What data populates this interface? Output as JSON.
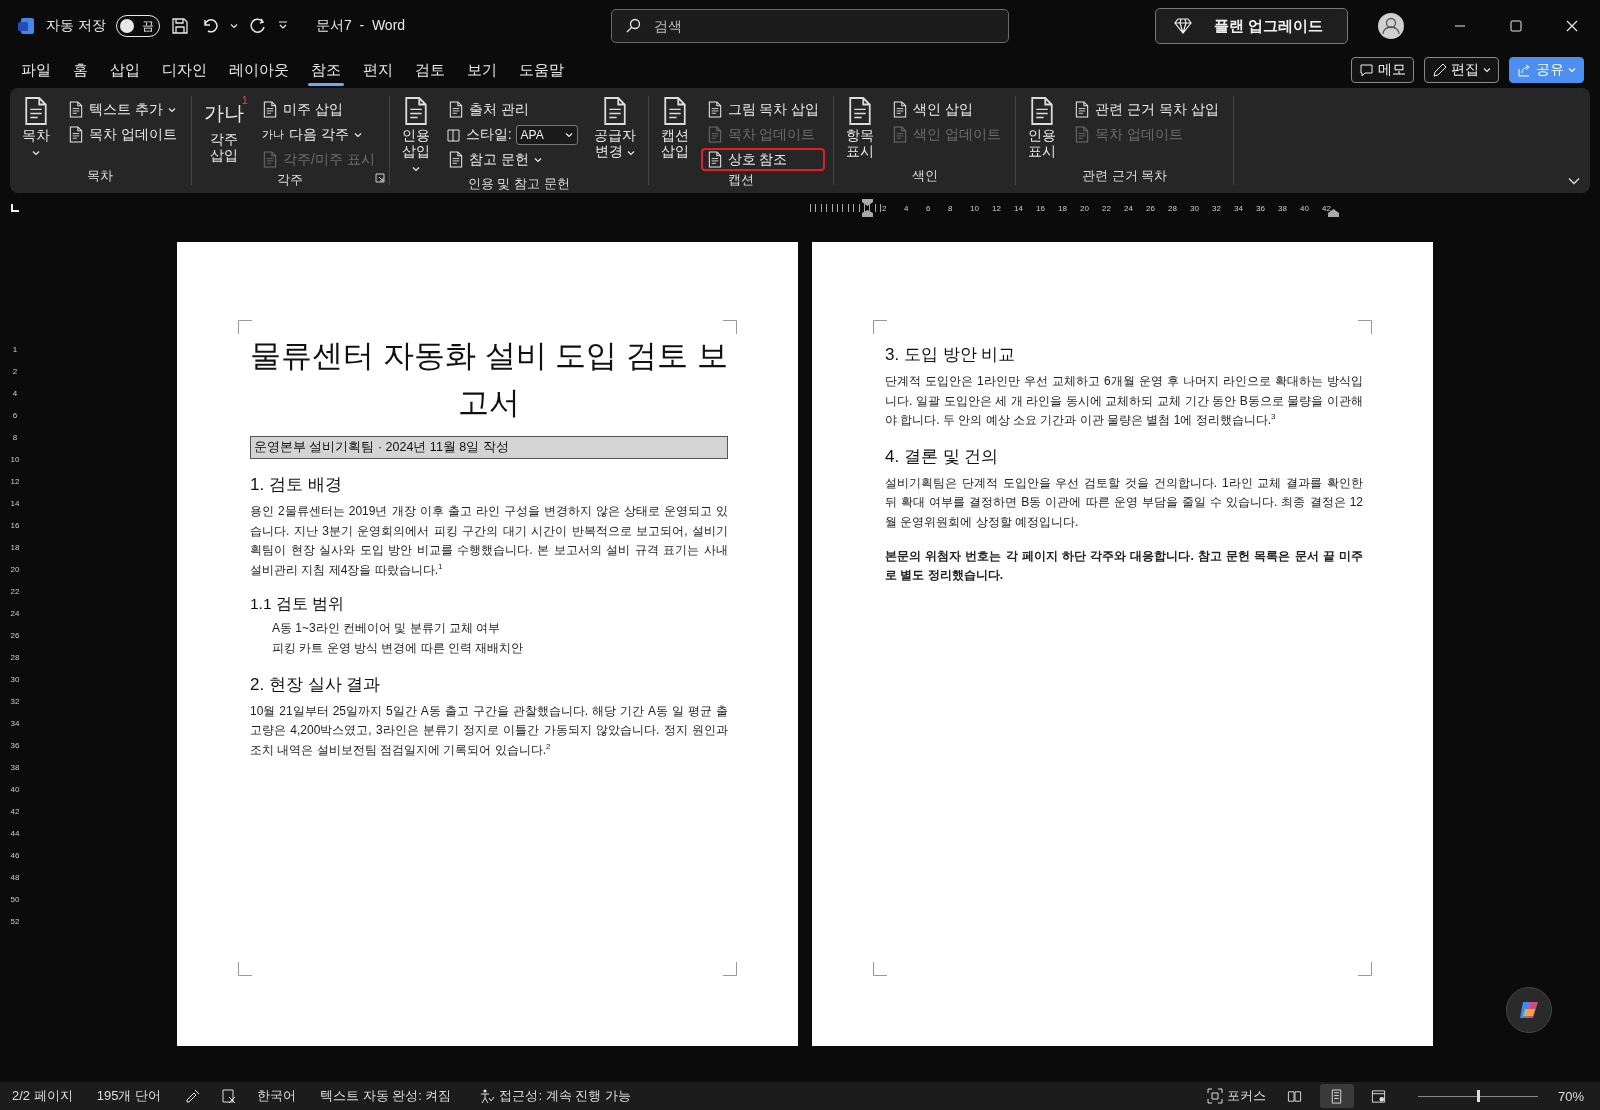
{
  "title_bar": {
    "autosave": {
      "label": "자동 저장",
      "on": false,
      "state_text": "끔"
    },
    "title": "문서7  -  Word",
    "search": {
      "placeholder": "검색"
    },
    "upgrade": "플랜 업그레이드"
  },
  "menu_tabs": [
    {
      "label": "파일",
      "selected": false
    },
    {
      "label": "홈",
      "selected": false
    },
    {
      "label": "삽입",
      "selected": false
    },
    {
      "label": "디자인",
      "selected": false
    },
    {
      "label": "레이아웃",
      "selected": false
    },
    {
      "label": "참조",
      "selected": true
    },
    {
      "label": "편지",
      "selected": false
    },
    {
      "label": "검토",
      "selected": false
    },
    {
      "label": "보기",
      "selected": false
    },
    {
      "label": "도움말",
      "selected": false
    }
  ],
  "header_buttons": [
    {
      "kind": "comment",
      "label": "메모"
    },
    {
      "kind": "edit",
      "label": "편집"
    },
    {
      "kind": "share",
      "label": "공유"
    }
  ],
  "ribbon_groups": [
    {
      "label": "목차",
      "launcher": false,
      "items": [
        {
          "kind": "large",
          "label": "목차",
          "dropdown": true
        },
        {
          "kind": "column",
          "commands": [
            {
              "kind": "button",
              "label": "텍스트 추가",
              "dropdown": true,
              "disabled": false,
              "highlighted": false
            },
            {
              "kind": "button",
              "label": "목차 업데이트",
              "dropdown": false,
              "disabled": false,
              "highlighted": false
            }
          ]
        }
      ]
    },
    {
      "label": "각주",
      "launcher": true,
      "items": [
        {
          "kind": "large",
          "label": "각주 삽입",
          "icon_text": "가나",
          "icon_mark": "1",
          "dropdown": false
        },
        {
          "kind": "column",
          "commands": [
            {
              "kind": "button",
              "label": "미주 삽입",
              "dropdown": false,
              "disabled": false,
              "highlighted": false
            },
            {
              "kind": "button",
              "label": "다음 각주",
              "icon_text": "가나",
              "dropdown": true,
              "disabled": false,
              "highlighted": false
            },
            {
              "kind": "button",
              "label": "각주/미주 표시",
              "dropdown": false,
              "disabled": true,
              "highlighted": false
            }
          ]
        }
      ]
    },
    {
      "label": "인용 및 참고 문헌",
      "launcher": false,
      "items": [
        {
          "kind": "large",
          "label": "인용 삽입",
          "dropdown": true
        },
        {
          "kind": "column",
          "commands": [
            {
              "kind": "button",
              "label": "출처 관리",
              "dropdown": false,
              "disabled": false,
              "highlighted": false
            },
            {
              "kind": "combo",
              "label": "스타일:",
              "value": "APA",
              "dropdown": true,
              "disabled": false,
              "highlighted": false
            },
            {
              "kind": "button",
              "label": "참고 문헌",
              "dropdown": true,
              "disabled": false,
              "highlighted": false
            }
          ]
        },
        {
          "kind": "large",
          "label": "공급자 변경",
          "dropdown": true
        }
      ]
    },
    {
      "label": "캡션",
      "launcher": false,
      "items": [
        {
          "kind": "large",
          "label": "캡션 삽입",
          "dropdown": false
        },
        {
          "kind": "column",
          "commands": [
            {
              "kind": "button",
              "label": "그림 목차 삽입",
              "dropdown": false,
              "disabled": false,
              "highlighted": false
            },
            {
              "kind": "button",
              "label": "목차 업데이트",
              "dropdown": false,
              "disabled": true,
              "highlighted": false
            },
            {
              "kind": "button",
              "label": "상호 참조",
              "dropdown": false,
              "disabled": false,
              "highlighted": true
            }
          ]
        }
      ]
    },
    {
      "label": "색인",
      "launcher": false,
      "items": [
        {
          "kind": "large",
          "label": "항목 표시",
          "dropdown": false
        },
        {
          "kind": "column",
          "commands": [
            {
              "kind": "button",
              "label": "색인 삽입",
              "dropdown": false,
              "disabled": false,
              "highlighted": false
            },
            {
              "kind": "button",
              "label": "색인 업데이트",
              "dropdown": false,
              "disabled": true,
              "highlighted": false
            }
          ]
        }
      ]
    },
    {
      "label": "관련 근거 목차",
      "launcher": false,
      "items": [
        {
          "kind": "large",
          "label": "인용 표시",
          "dropdown": false
        },
        {
          "kind": "column",
          "commands": [
            {
              "kind": "button",
              "label": "관련 근거 목차 삽입",
              "dropdown": false,
              "disabled": false,
              "highlighted": false
            },
            {
              "kind": "button",
              "label": "목차 업데이트",
              "dropdown": false,
              "disabled": true,
              "highlighted": false
            }
          ]
        }
      ]
    }
  ],
  "ruler": {
    "h_labels": [
      "2",
      "4",
      "6",
      "8",
      "10",
      "12",
      "14",
      "16",
      "18",
      "20",
      "22",
      "24",
      "26",
      "28",
      "30",
      "32",
      "34",
      "36",
      "38",
      "40",
      "42"
    ],
    "v_labels": [
      "1",
      "2",
      "4",
      "6",
      "8",
      "10",
      "12",
      "14",
      "16",
      "18",
      "20",
      "22",
      "24",
      "26",
      "28",
      "30",
      "32",
      "34",
      "36",
      "38",
      "40",
      "42",
      "44",
      "46",
      "48",
      "50",
      "52"
    ]
  },
  "pages": [
    {
      "blocks": [
        {
          "kind": "title",
          "text": "물류센터 자동화 설비 도입 검토 보고서"
        },
        {
          "kind": "boxed",
          "text": "운영본부 설비기획팀 · 2024년 11월 8일 작성"
        },
        {
          "kind": "h1",
          "text": "1. 검토 배경"
        },
        {
          "kind": "p",
          "text": "용인 2물류센터는 2019년 개장 이후 출고 라인 구성을 변경하지 않은 상태로 운영되고 있습니다. 지난 3분기 운영회의에서 피킹 구간의 대기 시간이 반복적으로 보고되어, 설비기획팀이 현장 실사와 도입 방안 비교를 수행했습니다. 본 보고서의 설비 규격 표기는 사내 설비관리 지침 제4장을 따랐습니다.$^{1}$"
        },
        {
          "kind": "h2",
          "text": "1.1 검토 범위"
        },
        {
          "kind": "indent",
          "text": "A동 1~3라인 컨베이어 및 분류기 교체 여부"
        },
        {
          "kind": "indent",
          "text": "피킹 카트 운영 방식 변경에 따른 인력 재배치안"
        },
        {
          "kind": "h1",
          "text": "2. 현장 실사 결과"
        },
        {
          "kind": "p",
          "text": "10월 21일부터 25일까지 5일간 A동 출고 구간을 관찰했습니다. 해당 기간 A동 일 평균 출고량은 4,200박스였고, 3라인은 분류기 정지로 이틀간 가동되지 않았습니다. 정지 원인과 조치 내역은 설비보전팀 점검일지에 기록되어 있습니다.$^{2}$"
        }
      ]
    },
    {
      "blocks": [
        {
          "kind": "h1",
          "text": "3. 도입 방안 비교"
        },
        {
          "kind": "p",
          "text": "단계적 도입안은 1라인만 우선 교체하고 6개월 운영 후 나머지 라인으로 확대하는 방식입니다. 일괄 도입안은 세 개 라인을 동시에 교체하되 교체 기간 동안 B동으로 물량을 이관해야 합니다. 두 안의 예상 소요 기간과 이관 물량은 별첨 1에 정리했습니다.$^{3}$"
        },
        {
          "kind": "h1",
          "text": "4. 결론 및 건의"
        },
        {
          "kind": "p",
          "text": "설비기획팀은 단계적 도입안을 우선 검토할 것을 건의합니다. 1라인 교체 결과를 확인한 뒤 확대 여부를 결정하면 B동 이관에 따른 운영 부담을 줄일 수 있습니다. 최종 결정은 12월 운영위원회에 상정할 예정입니다."
        },
        {
          "kind": "bold_p",
          "text": "본문의 위첨자 번호는 각 페이지 하단 각주와 대응합니다. 참고 문헌 목록은 문서 끝 미주로 별도 정리했습니다."
        }
      ]
    }
  ],
  "status_bar": {
    "page": "2/2 페이지",
    "words": "195개 단어",
    "language": "한국어",
    "autocomplete": "텍스트 자동 완성: 켜짐",
    "accessibility": "접근성: 계속 진행 가능",
    "focus": "포커스",
    "views": [
      {
        "kind": "read",
        "selected": false
      },
      {
        "kind": "print",
        "selected": true
      },
      {
        "kind": "web",
        "selected": false
      }
    ],
    "zoom": {
      "level": 0.5
    },
    "zoom_label": "70%"
  }
}
